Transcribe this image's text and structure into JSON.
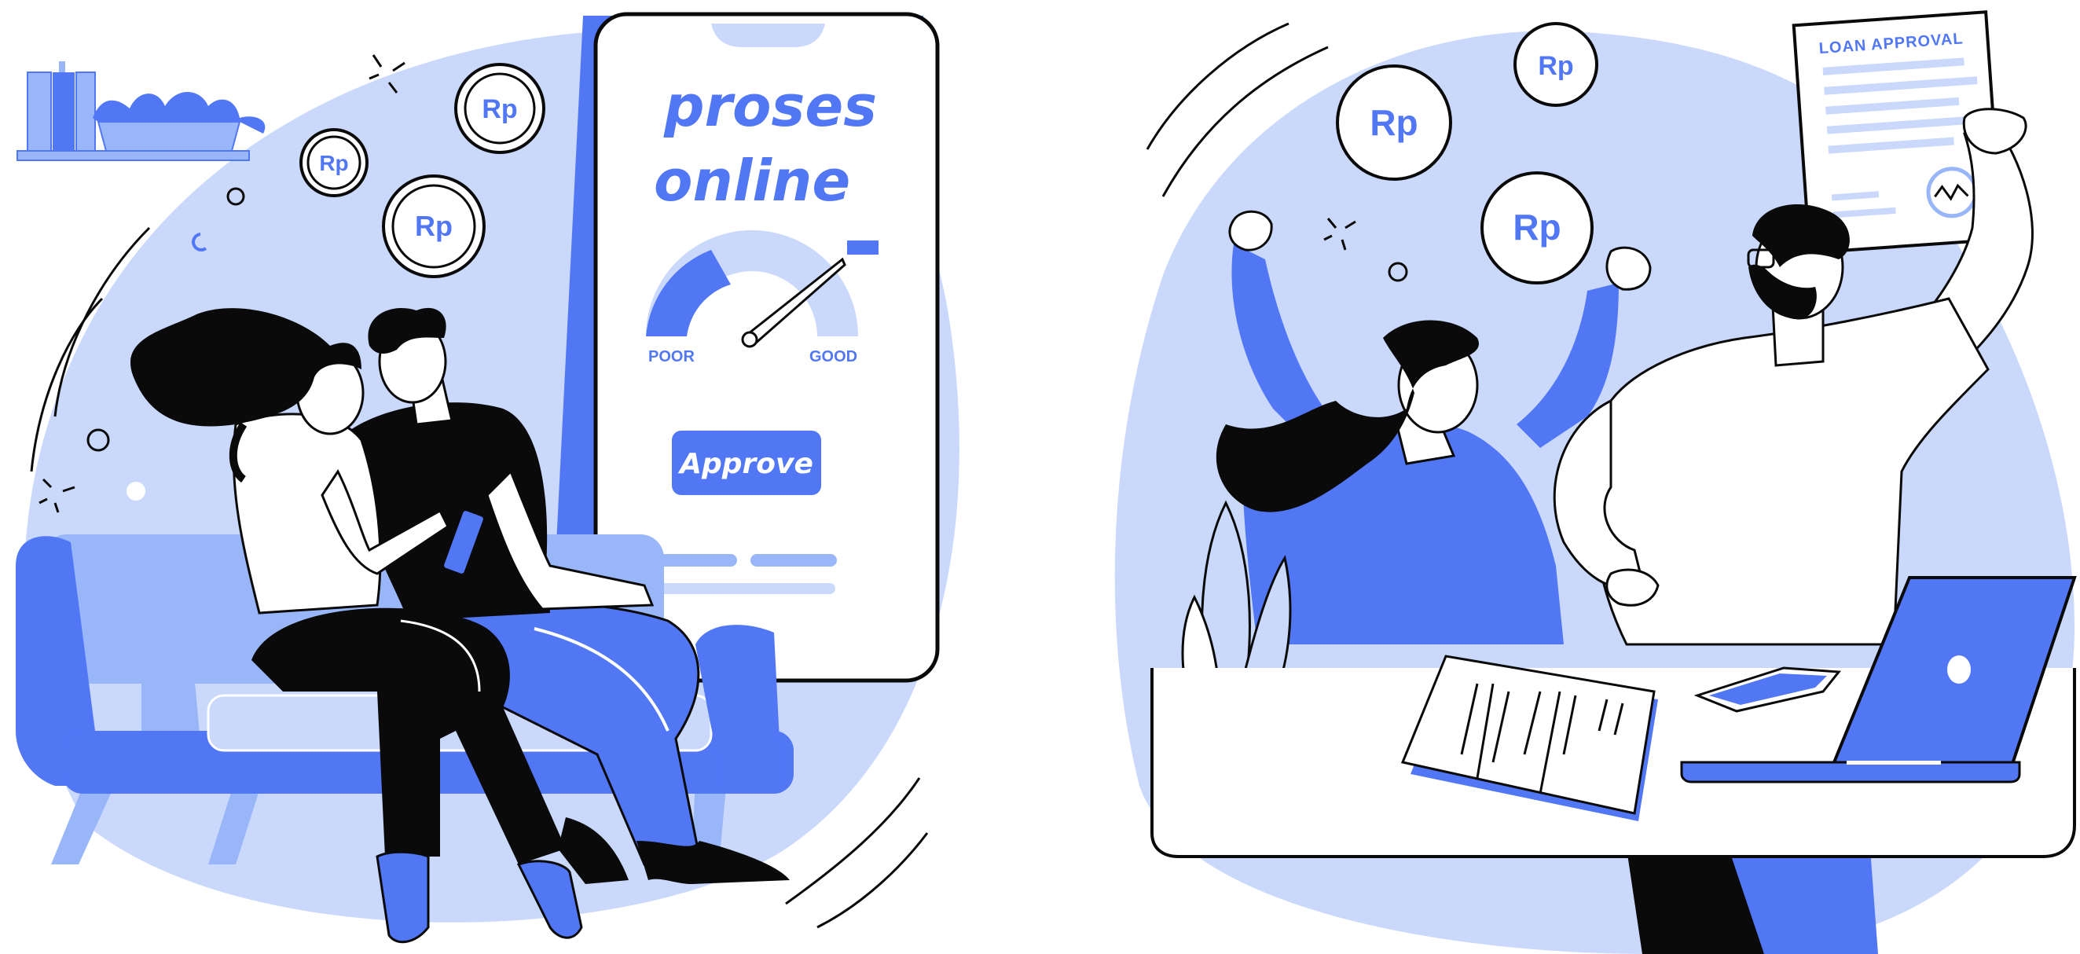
{
  "phone": {
    "headline_line1": "proses",
    "headline_line2": "online",
    "gauge_min_label": "POOR",
    "gauge_max_label": "GOOD",
    "approve_label": "Approve"
  },
  "coins": {
    "left": [
      "Rp",
      "Rp",
      "Rp"
    ],
    "right": [
      "Rp",
      "Rp",
      "Rp"
    ]
  },
  "document": {
    "title": "LOAN APPROVAL"
  },
  "colors": {
    "primary": "#5177F5",
    "light": "#C9D8FB",
    "mid": "#98B6F8",
    "ink": "#0A0A0A",
    "paper": "#FFFFFF"
  }
}
